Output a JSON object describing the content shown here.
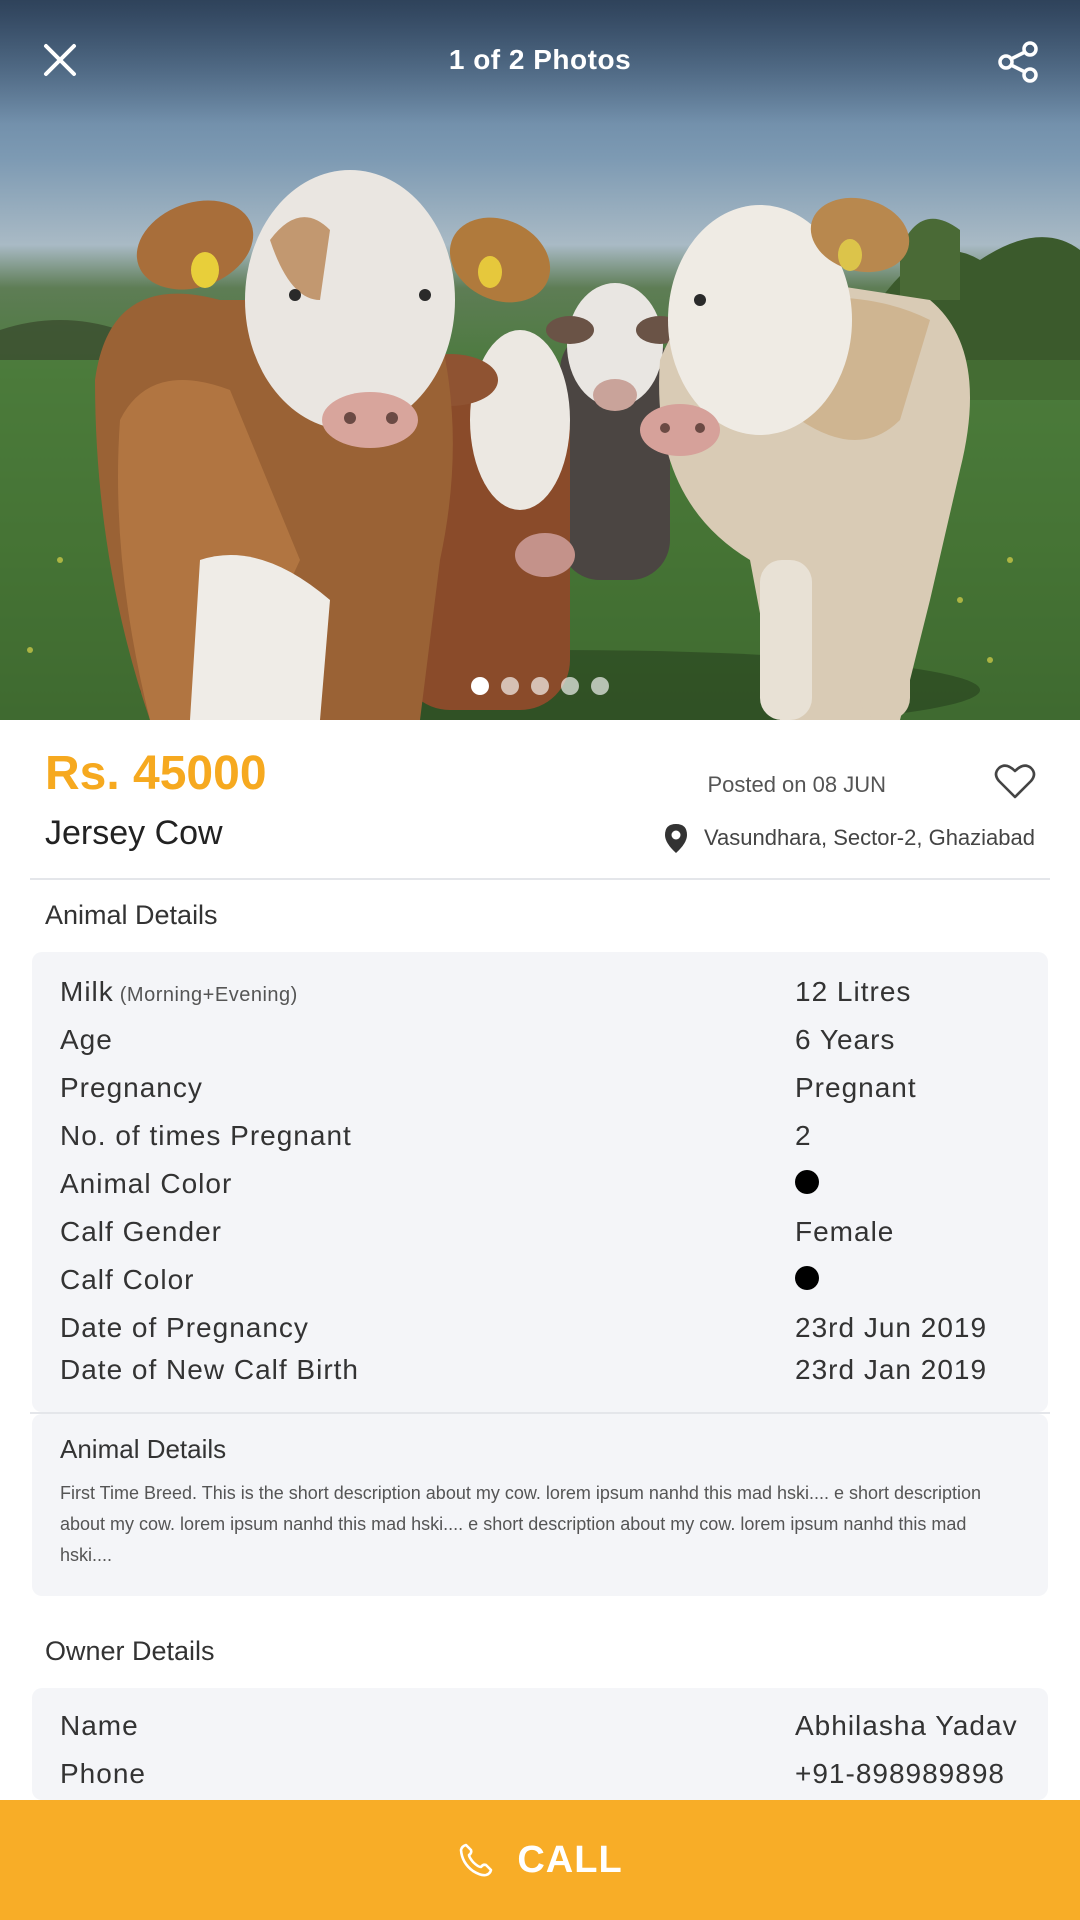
{
  "gallery": {
    "counter": "1 of 2 Photos",
    "dots_total": 5,
    "dots_active_index": 0
  },
  "listing": {
    "price": "Rs. 45000",
    "title": "Jersey Cow",
    "posted": "Posted on 08 JUN",
    "location": "Vasundhara, Sector-2, Ghaziabad"
  },
  "animal_details": {
    "heading": "Animal Details",
    "rows": [
      {
        "label": "Milk",
        "note": "(Morning+Evening)",
        "value": "12 Litres"
      },
      {
        "label": "Age",
        "value": "6 Years"
      },
      {
        "label": "Pregnancy",
        "value": "Pregnant"
      },
      {
        "label": "No. of times Pregnant",
        "value": "2"
      },
      {
        "label": "Animal Color",
        "value_color": "#000000"
      },
      {
        "label": "Calf Gender",
        "value": "Female"
      },
      {
        "label": "Calf Color",
        "value_color": "#000000"
      },
      {
        "label": "Date of Pregnancy",
        "value": "23rd Jun 2019"
      },
      {
        "label": "Date of New Calf Birth",
        "value": "23rd Jan 2019"
      }
    ]
  },
  "description": {
    "heading": "Animal Details",
    "text": "First Time Breed. This is the short description about my cow. lorem ipsum nanhd  this mad hski.... e short description about my cow. lorem ipsum nanhd  this mad hski.... e short description about my cow. lorem ipsum nanhd  this mad hski...."
  },
  "owner_details": {
    "heading": "Owner Details",
    "rows": [
      {
        "label": "Name",
        "value": "Abhilasha Yadav"
      },
      {
        "label": "Phone",
        "value": "+91-898989898"
      }
    ]
  },
  "call": {
    "label": "CALL"
  },
  "colors": {
    "accent": "#f8ad27",
    "price": "#f6a91f",
    "card_bg": "#f4f5f8"
  },
  "icons": [
    "close-icon",
    "share-icon",
    "heart-icon",
    "location-pin-icon",
    "phone-icon"
  ]
}
